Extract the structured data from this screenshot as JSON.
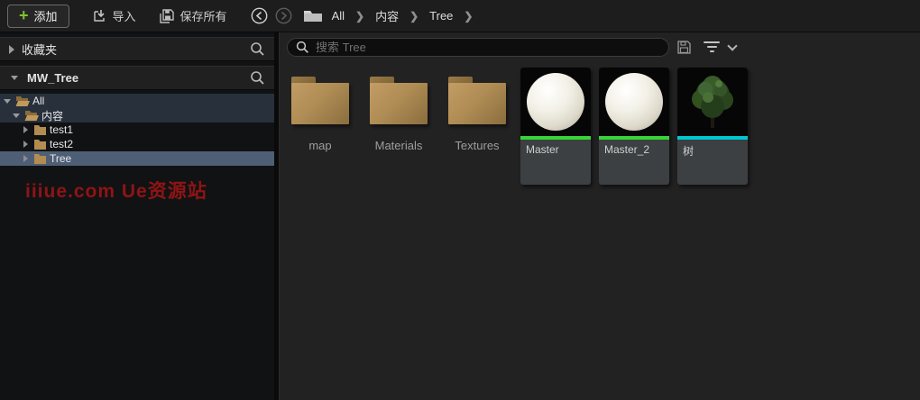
{
  "toolbar": {
    "add_label": "添加",
    "import_label": "导入",
    "save_all_label": "保存所有",
    "breadcrumb": [
      "All",
      "内容",
      "Tree"
    ]
  },
  "sidebar": {
    "favorites_header": "收藏夹",
    "collection_header": "MW_Tree",
    "tree": [
      {
        "label": "All"
      },
      {
        "label": "内容"
      },
      {
        "label": "test1"
      },
      {
        "label": "test2"
      },
      {
        "label": "Tree"
      }
    ],
    "watermark": "iiiue.com Ue资源站"
  },
  "main": {
    "search_placeholder": "搜索 Tree",
    "items": [
      {
        "name": "map",
        "type": "folder"
      },
      {
        "name": "Materials",
        "type": "folder"
      },
      {
        "name": "Textures",
        "type": "folder"
      },
      {
        "name": "Master",
        "type": "material",
        "bar_color": "#37d435"
      },
      {
        "name": "Master_2",
        "type": "material",
        "bar_color": "#37d435"
      },
      {
        "name": "树",
        "type": "static-mesh",
        "bar_color": "#00c6cf"
      }
    ]
  },
  "colors": {
    "accent_plus": "#84c12d",
    "open_row_bg": "#27303b",
    "selected_row_bg": "#4e5f75",
    "watermark": "#8f1414",
    "material_bar": "#37d435",
    "static_mesh_bar": "#00c6cf"
  }
}
